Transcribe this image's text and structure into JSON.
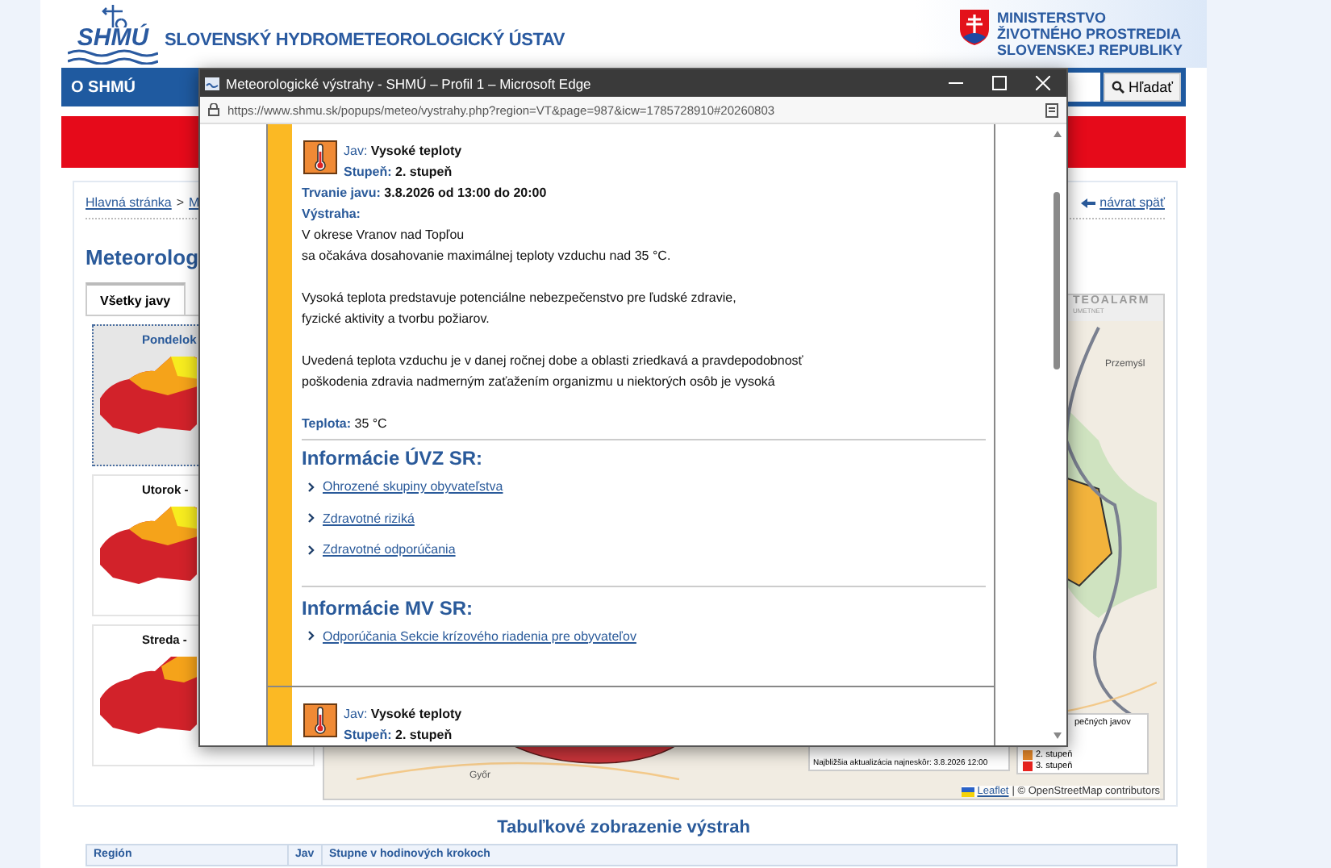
{
  "site_header": {
    "logo_text": "SHMÚ",
    "title": "SLOVENSKÝ HYDROMETEOROLOGICKÝ ÚSTAV",
    "ministry": [
      "MINISTERSTVO",
      "ŽIVOTNÉHO PROSTREDIA",
      "SLOVENSKEJ REPUBLIKY"
    ]
  },
  "nav": {
    "items": [
      "O SHMÚ"
    ],
    "search_button": "Hľadať"
  },
  "breadcrumb": {
    "separator": ">",
    "items": [
      "Hlavná stránka",
      "M"
    ],
    "back_link": "návrat späť"
  },
  "page_title": "Meteorolog",
  "tabs": [
    {
      "label": "Všetky javy",
      "selected": true
    }
  ],
  "days": [
    {
      "label": "Pondelok",
      "selected": true
    },
    {
      "label": "Utorok -",
      "selected": false
    },
    {
      "label": "Streda -",
      "selected": false
    }
  ],
  "map": {
    "brand": "TEOALARM",
    "brand_sub": "UMETNET",
    "places": [
      "Przemyśl",
      "Győr"
    ],
    "update_line": "Najbližšia aktualizácia najneskôr: 3.8.2026 12:00",
    "legend_title": "pečných javov",
    "legend": [
      {
        "label": "2. stupeň",
        "color": "#e8892a"
      },
      {
        "label": "3. stupeň",
        "color": "#e8231f"
      }
    ],
    "attribution_link": "Leaflet",
    "attribution": "| © OpenStreetMap contributors"
  },
  "table_section": {
    "title": "Tabuľkové zobrazenie výstrah",
    "columns": [
      "Región",
      "Jav",
      "Stupne v hodinových krokoch"
    ]
  },
  "popup": {
    "title": "Meteorologické výstrahy - SHMÚ – Profil 1 – Microsoft Edge",
    "url": "https://www.shmu.sk/popups/meteo/vystrahy.php?region=VT&page=987&icw=1785728910#20260803",
    "alerts": [
      {
        "fields": [
          {
            "label": "Jav:",
            "value": "Vysoké teploty"
          },
          {
            "label": "Stupeň:",
            "value": "2. stupeň"
          }
        ],
        "duration": {
          "label": "Trvanie javu:",
          "value": "3.8.2026 od 13:00 do 20:00"
        },
        "warning_label": "Výstraha:",
        "paragraphs": [
          [
            "V okrese Vranov nad Topľou",
            "sa očakáva dosahovanie maximálnej teploty vzduchu nad 35 °C."
          ],
          [
            "Vysoká teplota predstavuje potenciálne nebezpečenstvo pre ľudské zdravie,",
            "fyzické aktivity a tvorbu požiarov."
          ],
          [
            "Uvedená teplota vzduchu je v danej ročnej dobe a oblasti zriedkavá a pravdepodobnosť",
            "poškodenia zdravia nadmerným zaťažením organizmu u niektorých osôb je vysoká"
          ]
        ],
        "temperature": {
          "label": "Teplota:",
          "value": "35 °C"
        },
        "sections": [
          {
            "heading": "Informácie ÚVZ SR:",
            "links": [
              "Ohrozené skupiny obyvateľstva",
              "Zdravotné riziká",
              "Zdravotné odporúčania"
            ]
          },
          {
            "heading": "Informácie MV SR:",
            "links": [
              "Odporúčania Sekcie krízového riadenia pre obyvateľov"
            ]
          }
        ]
      },
      {
        "fields": [
          {
            "label": "Jav:",
            "value": "Vysoké teploty"
          },
          {
            "label": "Stupeň:",
            "value": "2. stupeň"
          }
        ]
      }
    ]
  }
}
